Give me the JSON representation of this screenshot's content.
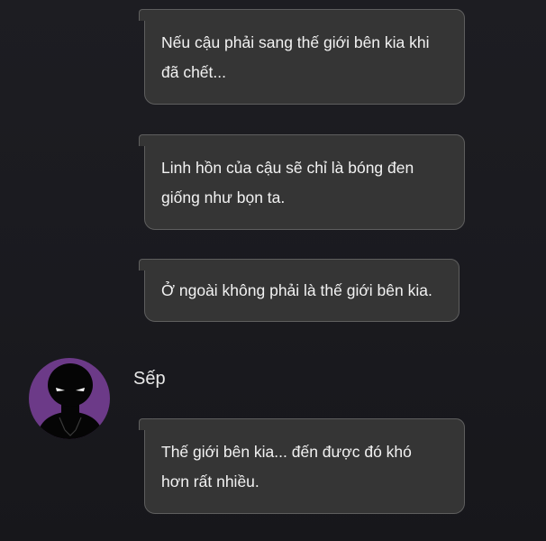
{
  "messages": [
    {
      "id": "m1",
      "side": "other",
      "text_lines": [
        "Nếu cậu phải sang thế giới bên kia khi",
        "đã chết..."
      ]
    },
    {
      "id": "m2",
      "side": "other",
      "text_lines": [
        "Linh hồn của cậu sẽ chỉ là bóng đen",
        "giống như bọn ta."
      ]
    },
    {
      "id": "m3",
      "side": "other",
      "text_lines": [
        "Ở ngoài không phải là thế giới bên kia."
      ]
    },
    {
      "id": "m4",
      "side": "other",
      "text_lines": [
        "Thế giới bên kia... đến được đó khó",
        "hơn rất nhiều."
      ]
    }
  ],
  "sender": {
    "name": "Sếp",
    "avatar_icon": "shadow-figure-avatar",
    "avatar_color": "#6c3a88"
  },
  "theme": {
    "background": "#1b1b20",
    "bubble_bg": "#353535",
    "bubble_border": "#5e5e5e",
    "text_color": "#f2f2f2"
  }
}
